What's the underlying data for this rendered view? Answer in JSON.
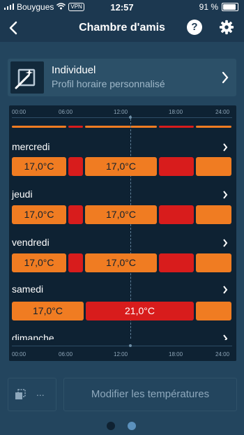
{
  "status_bar": {
    "carrier": "Bouygues",
    "vpn": "VPN",
    "time": "12:57",
    "battery": "91 %",
    "battery_level": 0.91
  },
  "header": {
    "title": "Chambre d'amis"
  },
  "profile": {
    "name": "Individuel",
    "subtitle": "Profil horaire personnalisé"
  },
  "schedule": {
    "time_ticks": [
      "00:00",
      "06:00",
      "12:00",
      "18:00",
      "24:00"
    ],
    "days": [
      {
        "name": "mercredi",
        "labels": [
          "17,0°C",
          "17,0°C"
        ]
      },
      {
        "name": "jeudi",
        "labels": [
          "17,0°C",
          "17,0°C"
        ]
      },
      {
        "name": "vendredi",
        "labels": [
          "17,0°C",
          "17,0°C"
        ]
      },
      {
        "name": "samedi",
        "labels": [
          "17,0°C",
          "21,0°C"
        ]
      },
      {
        "name": "dimanche"
      }
    ]
  },
  "actions": {
    "more_label": "...",
    "modify_label": "Modifier les températures"
  },
  "colors": {
    "comfort": "#f07c22",
    "eco": "#d81c1c",
    "background": "#1c3850"
  }
}
